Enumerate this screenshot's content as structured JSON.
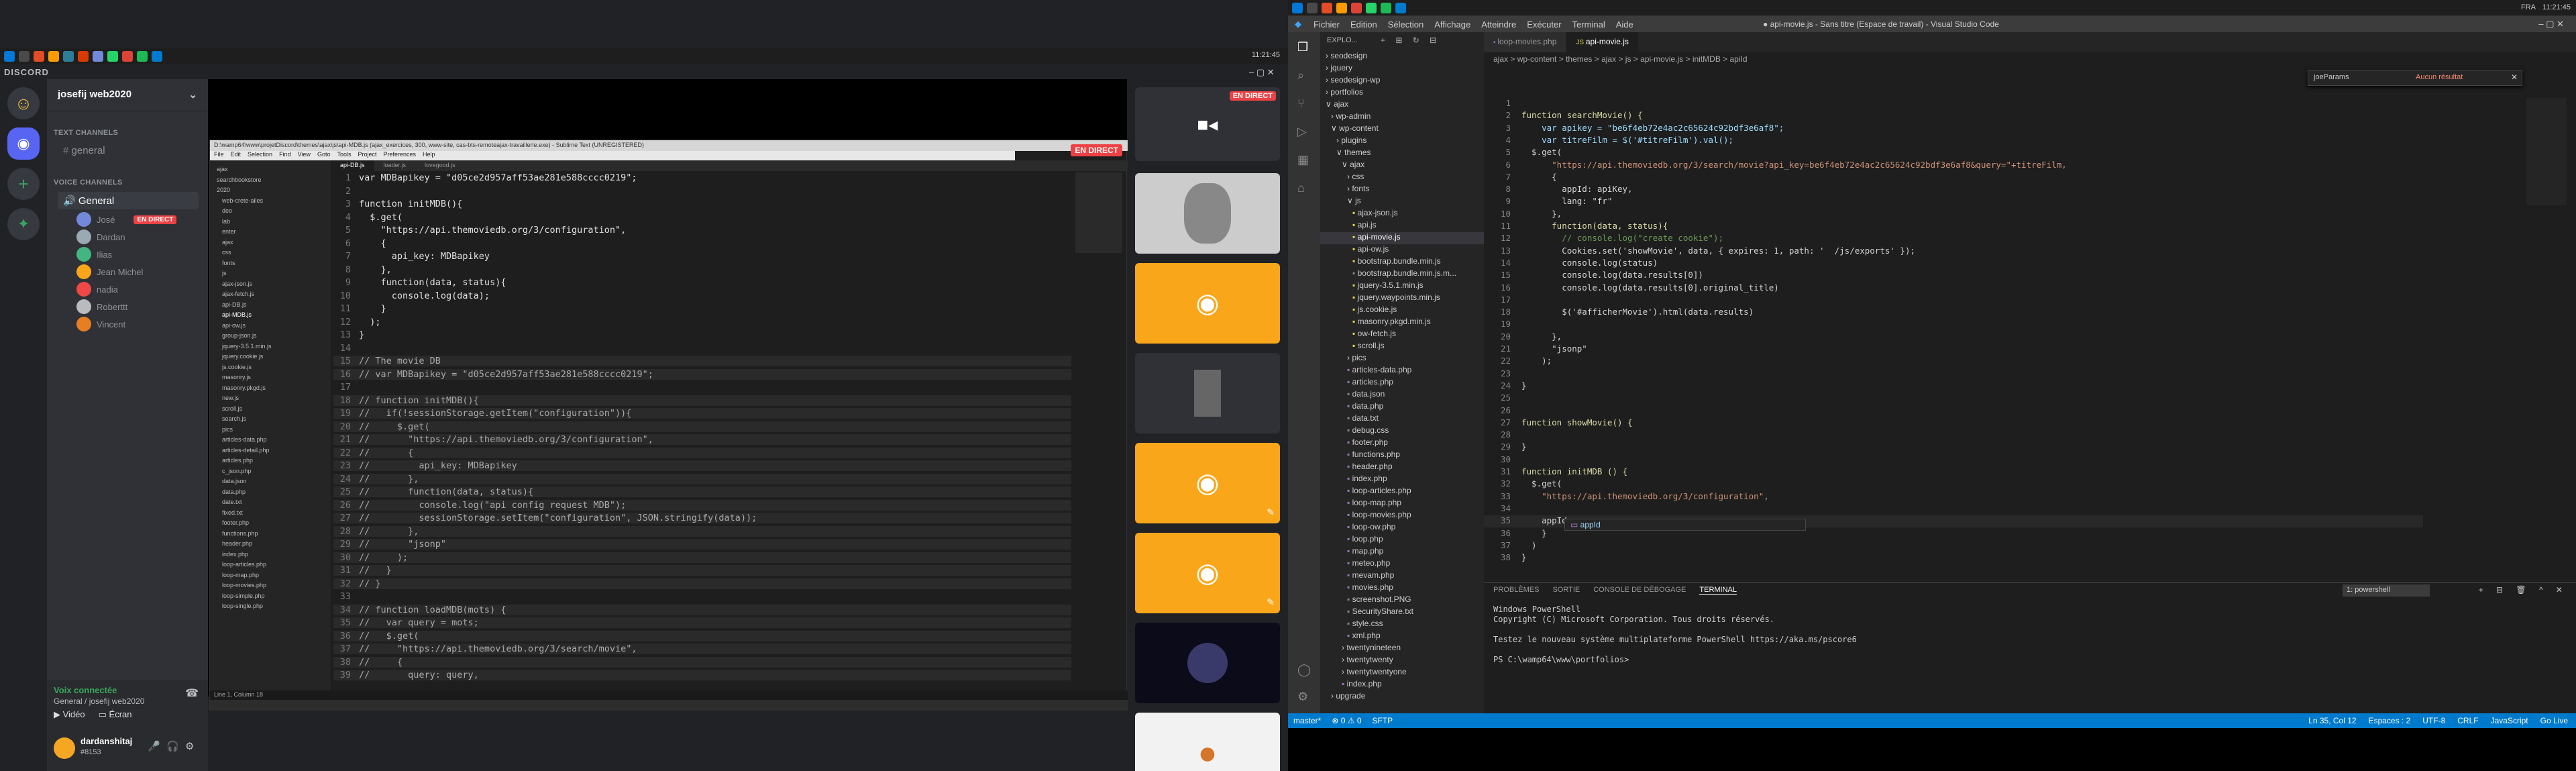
{
  "left": {
    "clock": "11:21:45",
    "brand": "DISCORD",
    "server_name": "josefij web2020",
    "text_channels_label": "TEXT CHANNELS",
    "text_channel": "general",
    "voice_channels_label": "VOICE CHANNELS",
    "voice_channel": "General",
    "voice_users": [
      "José",
      "Dardan",
      "Ilias",
      "Jean Michel",
      "nadia",
      "Roberttt",
      "Vincent"
    ],
    "live_label": "EN DIRECT",
    "voice_connected": "Voix connectée",
    "voice_location": "General / josefij web2020",
    "video_btn": "Vidéo",
    "screen_btn": "Écran",
    "username": "dardanshitaj",
    "user_tag": "#8153",
    "stream_live": "EN DIRECT",
    "sublime_title": "D:\\wamp64\\www\\projetDiscord\\themes\\ajax\\js\\api-MDB.js (ajax_exercices, 300, www-site, cas-bts-remoteajax-travaillerle.exe) - Sublime Text (UNREGISTERED)",
    "sublime_menu": [
      "File",
      "Edit",
      "Selection",
      "Find",
      "View",
      "Goto",
      "Tools",
      "Project",
      "Preferences",
      "Help"
    ],
    "sublime_tabs": [
      "api-DB.js",
      "loader.js",
      "lovegood.js"
    ],
    "sublime_status": "Line 1, Column 18",
    "sublime_tree": [
      "ajax",
      "searchbookstore",
      "2020",
      "web-crete-ailes",
      "deo",
      "lab",
      "enter",
      "ajax",
      "css",
      "fonts",
      "js",
      "ajax-json.js",
      "ajax-fetch.js",
      "api-DB.js",
      "api-MDB.js",
      "api-ow.js",
      "group-json.js",
      "jquery-3.5.1.min.js",
      "jquery.cookie.js",
      "js.cookie.js",
      "masonry.js",
      "masonry.pkgd.js",
      "new.js",
      "scroll.js",
      "search.js",
      "pics",
      "articles-data.php",
      "articles-detail.php",
      "articles.php",
      "c_json.php",
      "data.json",
      "data.php",
      "date.txt",
      "fixed.txt",
      "footer.php",
      "functions.php",
      "header.php",
      "index.php",
      "loop-articles.php",
      "loop-map.php",
      "loop-movies.php",
      "loop-simple.php",
      "loop-single.php"
    ],
    "sublime_code": [
      {
        "n": "1",
        "t": "var MDBapikey = \"d05ce2d957aff53ae281e588cccc0219\";"
      },
      {
        "n": "2",
        "t": ""
      },
      {
        "n": "3",
        "t": "function initMDB(){"
      },
      {
        "n": "4",
        "t": "  $.get("
      },
      {
        "n": "5",
        "t": "    \"https://api.themoviedb.org/3/configuration\","
      },
      {
        "n": "6",
        "t": "    {"
      },
      {
        "n": "7",
        "t": "      api_key: MDBapikey"
      },
      {
        "n": "8",
        "t": "    },"
      },
      {
        "n": "9",
        "t": "    function(data, status){"
      },
      {
        "n": "10",
        "t": "      console.log(data);"
      },
      {
        "n": "11",
        "t": "    }"
      },
      {
        "n": "12",
        "t": "  );"
      },
      {
        "n": "13",
        "t": "}"
      },
      {
        "n": "14",
        "t": ""
      },
      {
        "n": "15",
        "t": "// The movie DB"
      },
      {
        "n": "16",
        "t": "// var MDBapikey = \"d05ce2d957aff53ae281e588cccc0219\";"
      },
      {
        "n": "17",
        "t": ""
      },
      {
        "n": "18",
        "t": "// function initMDB(){"
      },
      {
        "n": "19",
        "t": "//   if(!sessionStorage.getItem(\"configuration\")){"
      },
      {
        "n": "20",
        "t": "//     $.get("
      },
      {
        "n": "21",
        "t": "//       \"https://api.themoviedb.org/3/configuration\","
      },
      {
        "n": "22",
        "t": "//       {"
      },
      {
        "n": "23",
        "t": "//         api_key: MDBapikey"
      },
      {
        "n": "24",
        "t": "//       },"
      },
      {
        "n": "25",
        "t": "//       function(data, status){"
      },
      {
        "n": "26",
        "t": "//         console.log(\"api config request MDB\");"
      },
      {
        "n": "27",
        "t": "//         sessionStorage.setItem(\"configuration\", JSON.stringify(data));"
      },
      {
        "n": "28",
        "t": "//       },"
      },
      {
        "n": "29",
        "t": "//       \"jsonp\""
      },
      {
        "n": "30",
        "t": "//     );"
      },
      {
        "n": "31",
        "t": "//   }"
      },
      {
        "n": "32",
        "t": "// }"
      },
      {
        "n": "33",
        "t": ""
      },
      {
        "n": "34",
        "t": "// function loadMDB(mots) {"
      },
      {
        "n": "35",
        "t": "//   var query = mots;"
      },
      {
        "n": "36",
        "t": "//   $.get("
      },
      {
        "n": "37",
        "t": "//     \"https://api.themoviedb.org/3/search/movie\","
      },
      {
        "n": "38",
        "t": "//     {"
      },
      {
        "n": "39",
        "t": "//       query: query,"
      }
    ]
  },
  "right": {
    "menu": [
      "Fichier",
      "Edition",
      "Sélection",
      "Affichage",
      "Atteindre",
      "Exécuter",
      "Terminal",
      "Aide"
    ],
    "window_title": "● api-movie.js - Sans titre (Espace de travail) - Visual Studio Code",
    "clock": "11:21:45",
    "lang": "FRA",
    "explorer_title": "EXPLO...",
    "tabs": [
      "loop-movies.php",
      "api-movie.js"
    ],
    "breadcrumb": "ajax > wp-content > themes > ajax > js > api-movie.js > initMDB > apiId",
    "find_value": "joeParams",
    "find_result": "Aucun résultat",
    "tree": [
      {
        "d": 0,
        "t": "› seodesign"
      },
      {
        "d": 0,
        "t": "› jquery"
      },
      {
        "d": 0,
        "t": "› seodesign-wp"
      },
      {
        "d": 0,
        "t": "› portfolios"
      },
      {
        "d": 0,
        "t": "∨ ajax"
      },
      {
        "d": 1,
        "t": "› wp-admin"
      },
      {
        "d": 1,
        "t": "∨ wp-content"
      },
      {
        "d": 2,
        "t": "› plugins"
      },
      {
        "d": 2,
        "t": "∨ themes"
      },
      {
        "d": 3,
        "t": "∨ ajax"
      },
      {
        "d": 4,
        "t": "› css"
      },
      {
        "d": 4,
        "t": "› fonts"
      },
      {
        "d": 4,
        "t": "∨ js"
      },
      {
        "d": 5,
        "t": "ajax-json.js"
      },
      {
        "d": 5,
        "t": "api.js"
      },
      {
        "d": 5,
        "t": "api-movie.js"
      },
      {
        "d": 5,
        "t": "api-ow.js"
      },
      {
        "d": 5,
        "t": "bootstrap.bundle.min.js"
      },
      {
        "d": 5,
        "t": "bootstrap.bundle.min.js.m..."
      },
      {
        "d": 5,
        "t": "jquery-3.5.1.min.js"
      },
      {
        "d": 5,
        "t": "jquery.waypoints.min.js"
      },
      {
        "d": 5,
        "t": "js.cookie.js"
      },
      {
        "d": 5,
        "t": "masonry.pkgd.min.js"
      },
      {
        "d": 5,
        "t": "ow-fetch.js"
      },
      {
        "d": 5,
        "t": "scroll.js"
      },
      {
        "d": 4,
        "t": "› pics"
      },
      {
        "d": 4,
        "t": "articles-data.php"
      },
      {
        "d": 4,
        "t": "articles.php"
      },
      {
        "d": 4,
        "t": "data.json"
      },
      {
        "d": 4,
        "t": "data.php"
      },
      {
        "d": 4,
        "t": "data.txt"
      },
      {
        "d": 4,
        "t": "debug.css"
      },
      {
        "d": 4,
        "t": "footer.php"
      },
      {
        "d": 4,
        "t": "functions.php"
      },
      {
        "d": 4,
        "t": "header.php"
      },
      {
        "d": 4,
        "t": "index.php"
      },
      {
        "d": 4,
        "t": "loop-articles.php"
      },
      {
        "d": 4,
        "t": "loop-map.php"
      },
      {
        "d": 4,
        "t": "loop-movies.php"
      },
      {
        "d": 4,
        "t": "loop-ow.php"
      },
      {
        "d": 4,
        "t": "loop.php"
      },
      {
        "d": 4,
        "t": "map.php"
      },
      {
        "d": 4,
        "t": "meteo.php"
      },
      {
        "d": 4,
        "t": "mevam.php"
      },
      {
        "d": 4,
        "t": "movies.php"
      },
      {
        "d": 4,
        "t": "screenshot.PNG"
      },
      {
        "d": 4,
        "t": "SecurityShare.txt"
      },
      {
        "d": 4,
        "t": "style.css"
      },
      {
        "d": 4,
        "t": "xml.php"
      },
      {
        "d": 3,
        "t": "› twentynineteen"
      },
      {
        "d": 3,
        "t": "› twentytwenty"
      },
      {
        "d": 3,
        "t": "› twentytwentyone"
      },
      {
        "d": 3,
        "t": "index.php"
      },
      {
        "d": 1,
        "t": "› upgrade"
      }
    ],
    "code": [
      {
        "n": "1",
        "t": ""
      },
      {
        "n": "2",
        "t": "function searchMovie() {"
      },
      {
        "n": "3",
        "t": "    var apikey = \"be6f4eb72e4ac2c65624c92bdf3e6af8\";"
      },
      {
        "n": "4",
        "t": "    var titreFilm = $('#titreFilm').val();"
      },
      {
        "n": "5",
        "t": "  $.get("
      },
      {
        "n": "6",
        "t": "      \"https://api.themoviedb.org/3/search/movie?api_key=be6f4eb72e4ac2c65624c92bdf3e6af8&query=\"+titreFilm,"
      },
      {
        "n": "7",
        "t": "      {"
      },
      {
        "n": "8",
        "t": "        appId: apiKey,"
      },
      {
        "n": "9",
        "t": "        lang: \"fr\""
      },
      {
        "n": "10",
        "t": "      },"
      },
      {
        "n": "11",
        "t": "      function(data, status){"
      },
      {
        "n": "12",
        "t": "        // console.log(\"create cookie\");"
      },
      {
        "n": "13",
        "t": "        Cookies.set('showMovie', data, { expires: 1, path: '  /js/exports' });"
      },
      {
        "n": "14",
        "t": "        console.log(status)"
      },
      {
        "n": "15",
        "t": "        console.log(data.results[0])"
      },
      {
        "n": "16",
        "t": "        console.log(data.results[0].original_title)"
      },
      {
        "n": "17",
        "t": ""
      },
      {
        "n": "18",
        "t": "        $('#afficherMovie').html(data.results)"
      },
      {
        "n": "19",
        "t": ""
      },
      {
        "n": "20",
        "t": "      },"
      },
      {
        "n": "21",
        "t": "      \"jsonp\""
      },
      {
        "n": "22",
        "t": "    );"
      },
      {
        "n": "23",
        "t": ""
      },
      {
        "n": "24",
        "t": "}"
      },
      {
        "n": "25",
        "t": ""
      },
      {
        "n": "26",
        "t": ""
      },
      {
        "n": "27",
        "t": "function showMovie() {"
      },
      {
        "n": "28",
        "t": ""
      },
      {
        "n": "29",
        "t": "}"
      },
      {
        "n": "30",
        "t": ""
      },
      {
        "n": "31",
        "t": "function initMDB () {"
      },
      {
        "n": "32",
        "t": "  $.get("
      },
      {
        "n": "33",
        "t": "    \"https://api.themoviedb.org/3/configuration\","
      },
      {
        "n": "34",
        "t": ""
      },
      {
        "n": "35",
        "t": "    appId"
      },
      {
        "n": "36",
        "t": "    }"
      },
      {
        "n": "37",
        "t": "  )"
      },
      {
        "n": "38",
        "t": "}"
      }
    ],
    "autocomplete": "appId",
    "panel_tabs": [
      "PROBLÈMES",
      "SORTIE",
      "CONSOLE DE DÉBOGAGE",
      "TERMINAL"
    ],
    "terminal_selector": "1: powershell",
    "terminal": [
      "Windows PowerShell",
      "Copyright (C) Microsoft Corporation. Tous droits réservés.",
      "",
      "Testez le nouveau système multiplateforme PowerShell https://aka.ms/pscore6",
      "",
      "PS C:\\wamp64\\www\\portfolios> "
    ],
    "status_left": [
      "master*",
      "⊗ 0 ⚠ 0",
      "SFTP"
    ],
    "status_right": [
      "Ln 35, Col 12",
      "Espaces : 2",
      "UTF-8",
      "CRLF",
      "JavaScript",
      "Go Live"
    ]
  }
}
